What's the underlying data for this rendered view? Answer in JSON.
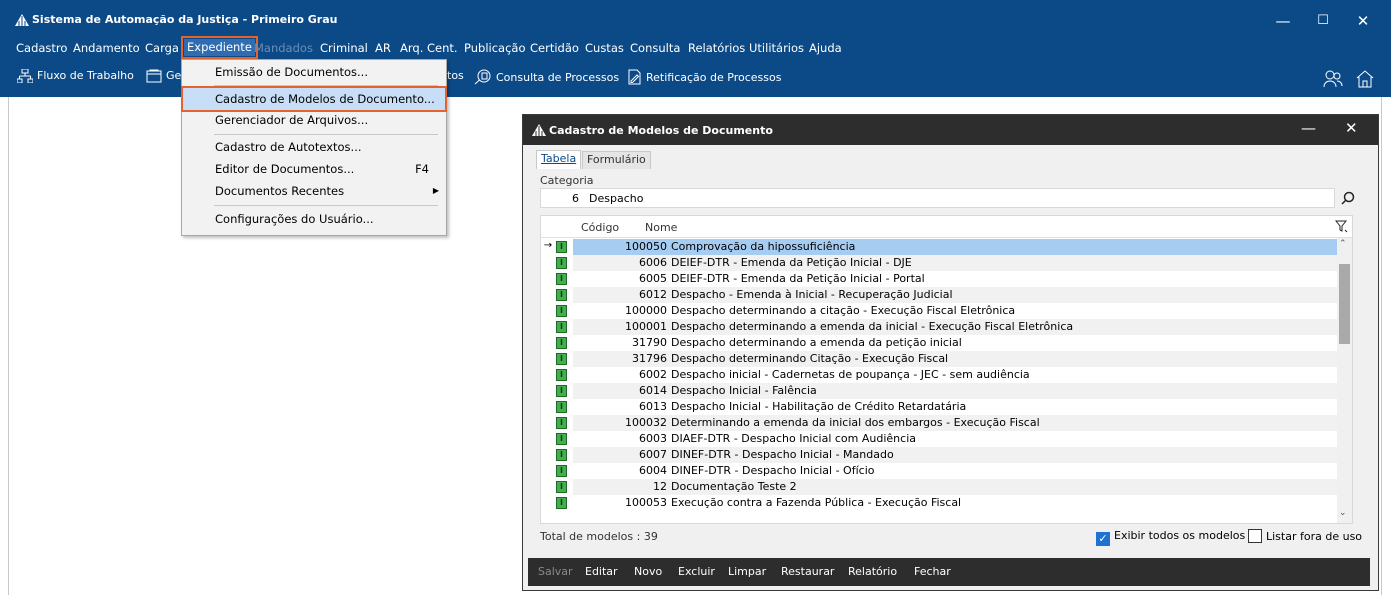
{
  "window": {
    "title": "Sistema de Automação da Justiça - Primeiro Grau",
    "minimize_glyph": "—",
    "maximize_glyph": "☐",
    "close_glyph": "✕"
  },
  "menubar": {
    "items": [
      {
        "label": "Cadastro"
      },
      {
        "label": "Andamento"
      },
      {
        "label": "Carga"
      },
      {
        "label": "Expediente",
        "state": "active"
      },
      {
        "label": "Mandados",
        "state": "disabled"
      },
      {
        "label": "Criminal"
      },
      {
        "label": "AR"
      },
      {
        "label": "Arq. Cent."
      },
      {
        "label": "Publicação"
      },
      {
        "label": "Certidão"
      },
      {
        "label": "Custas"
      },
      {
        "label": "Consulta"
      },
      {
        "label": "Relatórios"
      },
      {
        "label": "Utilitários"
      },
      {
        "label": "Ajuda"
      }
    ]
  },
  "toolbar": {
    "items": [
      {
        "label": "Fluxo de Trabalho",
        "icon": "workflow-icon"
      },
      {
        "label": "Ge",
        "icon": "document-manager-icon"
      },
      {
        "label": "tos",
        "icon": ""
      },
      {
        "label": "Consulta de Processos",
        "icon": "search-process-icon"
      },
      {
        "label": "Retificação de Processos",
        "icon": "edit-process-icon"
      }
    ],
    "right_icons": [
      "users-icon",
      "home-icon"
    ]
  },
  "dropdown": {
    "items": [
      {
        "label": "Emissão de Documentos...",
        "shortcut": "",
        "submenu": false
      },
      {
        "label": "Cadastro de Modelos de Documento...",
        "shortcut": "",
        "submenu": false,
        "highlighted": true
      },
      {
        "label": "Gerenciador de Arquivos...",
        "shortcut": "",
        "submenu": false
      },
      {
        "label": "Cadastro de Autotextos...",
        "shortcut": "",
        "submenu": false
      },
      {
        "label": "Editor de Documentos...",
        "shortcut": "F4",
        "submenu": false
      },
      {
        "label": "Documentos Recentes",
        "shortcut": "",
        "submenu": true
      },
      {
        "label": "Configurações do Usuário...",
        "shortcut": "",
        "submenu": false
      }
    ]
  },
  "dialog": {
    "title": "Cadastro de Modelos de Documento",
    "tabs": [
      {
        "label": "Tabela",
        "active": true
      },
      {
        "label": "Formulário",
        "active": false
      }
    ],
    "category": {
      "label": "Categoria",
      "code": "6",
      "name": "Despacho"
    },
    "grid": {
      "columns": [
        "Código",
        "Nome"
      ],
      "rows": [
        {
          "code": "100050",
          "name": "Comprovação da hipossuficiência",
          "selected": true
        },
        {
          "code": "6006",
          "name": "DEIEF-DTR - Emenda da Petição Inicial - DJE"
        },
        {
          "code": "6005",
          "name": "DEIEF-DTR - Emenda da Petição Inicial - Portal"
        },
        {
          "code": "6012",
          "name": "Despacho - Emenda à Inicial - Recuperação Judicial"
        },
        {
          "code": "100000",
          "name": "Despacho determinando a citação - Execução Fiscal Eletrônica"
        },
        {
          "code": "100001",
          "name": "Despacho determinando a emenda da inicial - Execução Fiscal Eletrônica"
        },
        {
          "code": "31790",
          "name": "Despacho determinando a emenda da petição inicial"
        },
        {
          "code": "31796",
          "name": "Despacho determinando Citação - Execução Fiscal"
        },
        {
          "code": "6002",
          "name": "Despacho inicial - Cadernetas de poupança - JEC - sem audiência"
        },
        {
          "code": "6014",
          "name": "Despacho Inicial - Falência"
        },
        {
          "code": "6013",
          "name": "Despacho Inicial - Habilitação de Crédito Retardatária"
        },
        {
          "code": "100032",
          "name": "Determinando a emenda da inicial dos embargos - Execução Fiscal"
        },
        {
          "code": "6003",
          "name": "DIAEF-DTR - Despacho Inicial com Audiência"
        },
        {
          "code": "6007",
          "name": "DINEF-DTR - Despacho Inicial - Mandado"
        },
        {
          "code": "6004",
          "name": "DINEF-DTR - Despacho Inicial - Ofício"
        },
        {
          "code": "12",
          "name": "Documentação Teste 2"
        },
        {
          "code": "100053",
          "name": "Execução contra a Fazenda Pública - Execução Fiscal"
        }
      ]
    },
    "total_label": "Total de modelos : 39",
    "show_all": {
      "label": "Exibir todos os modelos",
      "checked": true
    },
    "list_unused": {
      "label": "Listar fora de uso",
      "checked": false
    },
    "actions": [
      {
        "label": "Salvar",
        "disabled": true
      },
      {
        "label": "Editar",
        "disabled": false
      },
      {
        "label": "Novo",
        "disabled": false
      },
      {
        "label": "Excluir",
        "disabled": false
      },
      {
        "label": "Limpar",
        "disabled": false
      },
      {
        "label": "Restaurar",
        "disabled": false
      },
      {
        "label": "Relatório",
        "disabled": false
      },
      {
        "label": "Fechar",
        "disabled": false
      }
    ],
    "selected_row_indicator": "→",
    "status_glyph": "I"
  },
  "colors": {
    "title_bar": "#0c4a87",
    "dialog_title": "#2d2d2d",
    "selected_row": "#a6cdf1",
    "highlight_outline": "#e4632c",
    "status_green": "#3fb04c"
  }
}
